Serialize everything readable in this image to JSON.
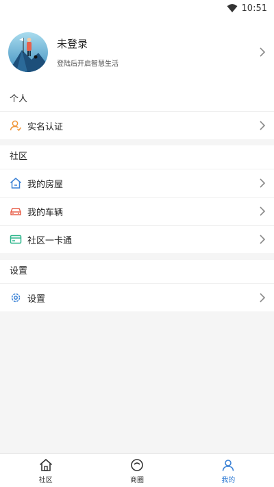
{
  "status_bar": {
    "time": "10:51"
  },
  "profile": {
    "name": "未登录",
    "subtitle": "登陆后开启智慧生活"
  },
  "personal": {
    "title": "个人",
    "items": [
      {
        "label": "实名认证",
        "icon": "user-verify-icon"
      }
    ]
  },
  "community": {
    "title": "社区",
    "items": [
      {
        "label": "我的房屋",
        "icon": "house-icon"
      },
      {
        "label": "我的车辆",
        "icon": "car-icon"
      },
      {
        "label": "社区一卡通",
        "icon": "card-icon"
      }
    ]
  },
  "settings": {
    "title": "设置",
    "items": [
      {
        "label": "设置",
        "icon": "gear-icon"
      }
    ]
  },
  "tabbar": {
    "tabs": [
      {
        "label": "社区"
      },
      {
        "label": "商圈"
      },
      {
        "label": "我的"
      }
    ]
  },
  "colors": {
    "accent": "#3b82d6",
    "orange": "#f0973a",
    "red": "#e8604c",
    "green": "#2bb58a",
    "blue": "#3b82d6"
  }
}
